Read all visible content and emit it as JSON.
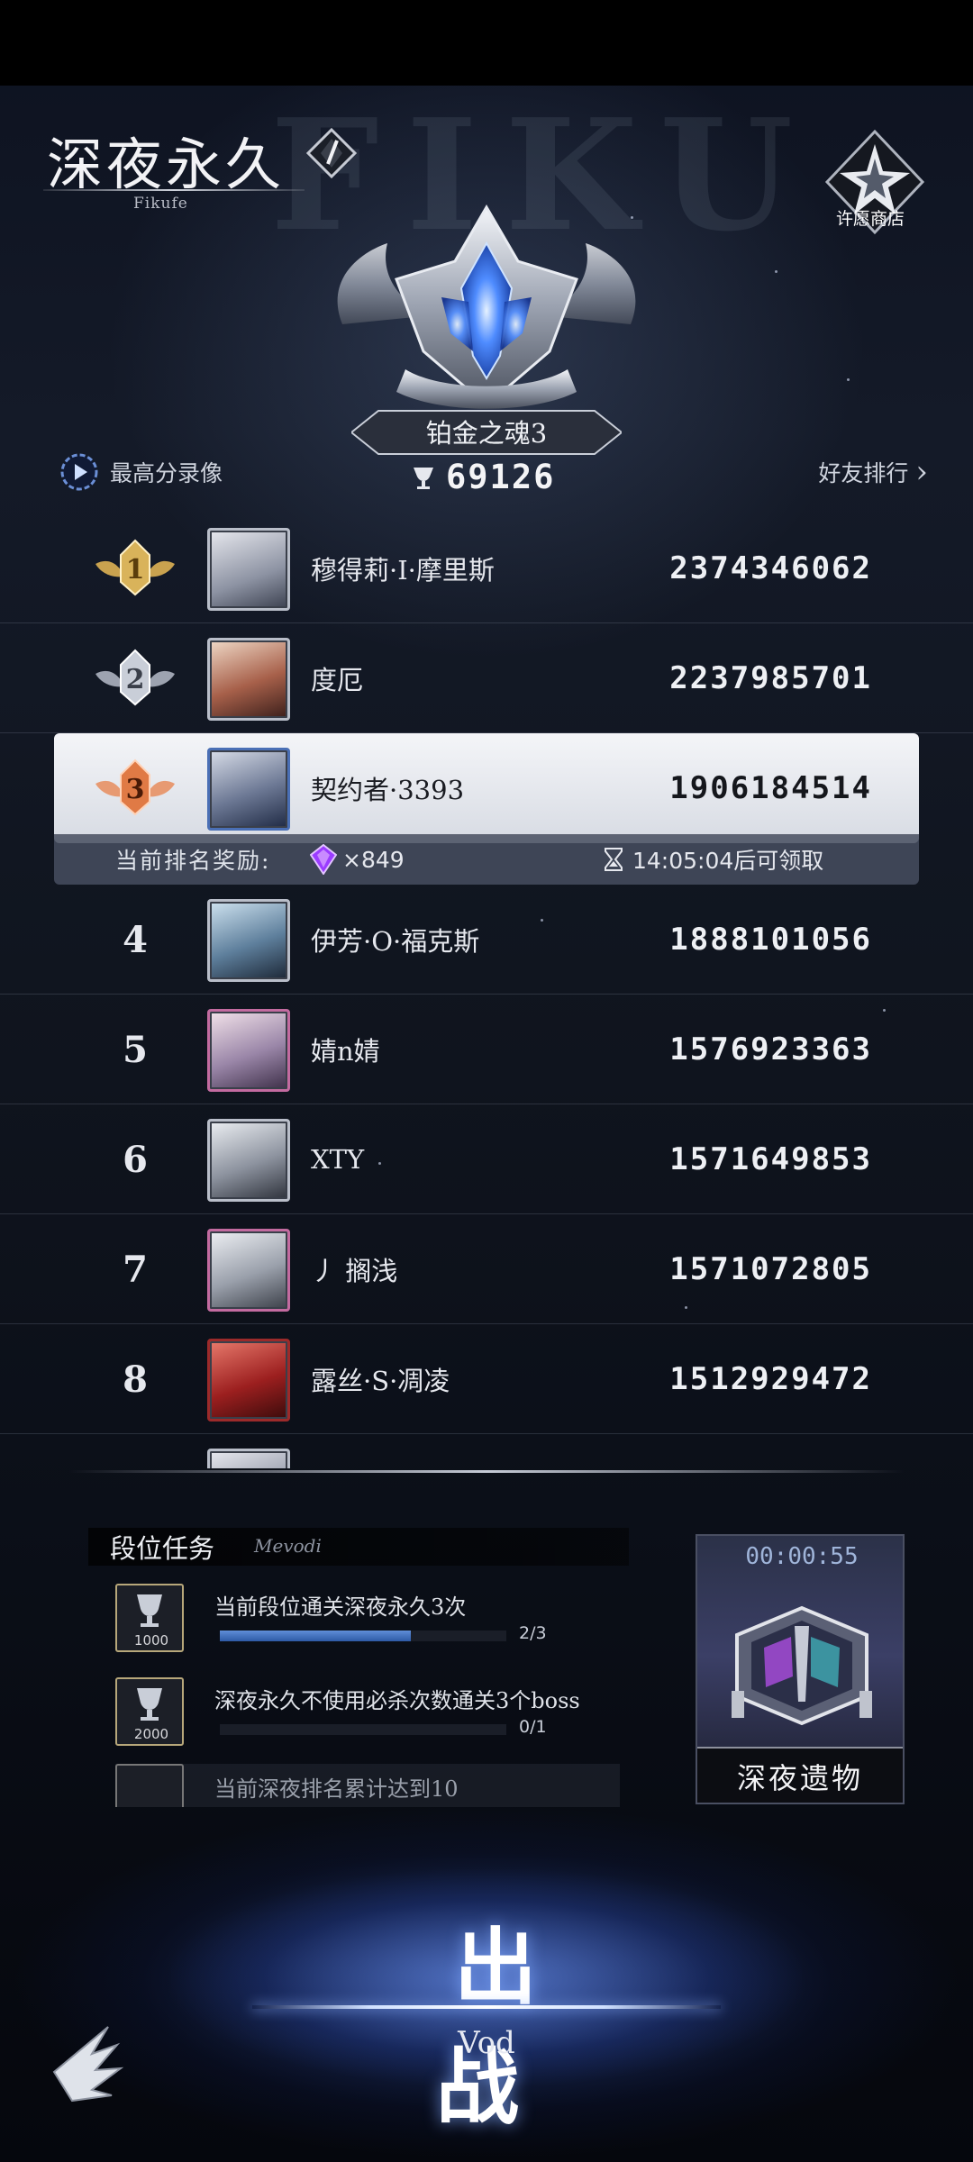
{
  "header": {
    "logo_title": "深夜永久",
    "logo_sub": "Fikufe",
    "bg_letters": "FIKU",
    "wish_shop_label": "许愿商店"
  },
  "rank_badge": {
    "name": "铂金之魂3",
    "trophy_score": "69126"
  },
  "links": {
    "best_replay": "最高分录像",
    "friend_rank": "好友排行",
    "friend_rank_arrow": "›"
  },
  "leaderboard": {
    "rows": [
      {
        "rank": "1",
        "name": "穆得莉·I·摩里斯",
        "score": "2374346062",
        "medal": "gold"
      },
      {
        "rank": "2",
        "name": "度厄",
        "score": "2237985701",
        "medal": "silver"
      },
      {
        "rank": "3",
        "name": "契约者·3393",
        "score": "1906184514",
        "medal": "bronze",
        "is_self": true
      },
      {
        "rank": "4",
        "name": "伊芳·O·福克斯",
        "score": "1888101056"
      },
      {
        "rank": "5",
        "name": "婧n婧",
        "score": "1576923363"
      },
      {
        "rank": "6",
        "name": "XTY",
        "score": "1571649853"
      },
      {
        "rank": "7",
        "name": "丿 搁浅",
        "score": "1571072805"
      },
      {
        "rank": "8",
        "name": "露丝·S·凋凌",
        "score": "1512929472"
      }
    ],
    "reward": {
      "label": "当前排名奖励:",
      "count": "×849",
      "timer": "14:05:04后可领取"
    }
  },
  "tasks": {
    "title": "段位任务",
    "subtitle": "Mevodi",
    "items": [
      {
        "text": "当前段位通关深夜永久3次",
        "reward": "1000",
        "progress": "2/3",
        "fraction": 0.667
      },
      {
        "text": "深夜永久不使用必杀次数通关3个boss",
        "reward": "2000",
        "progress": "0/1",
        "fraction": 0
      },
      {
        "text": "当前深夜排名累计达到10",
        "reward": "",
        "progress": "",
        "fraction": 0
      }
    ]
  },
  "relic": {
    "timer": "00:00:55",
    "label": "深夜遗物"
  },
  "battle": {
    "label": "出战",
    "sub": "Vod"
  },
  "colors": {
    "gold_medal": "#d9b35a",
    "silver_medal": "#c9ced8",
    "bronze_medal": "#e07a45",
    "gem": "#9b3cff",
    "progress": "#3f6fc2"
  }
}
